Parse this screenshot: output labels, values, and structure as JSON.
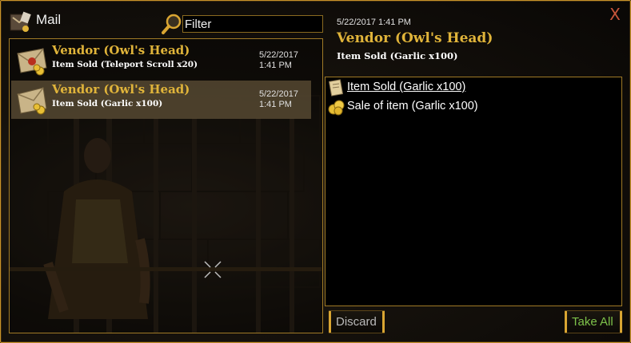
{
  "window": {
    "title": "Mail",
    "close_label": "X"
  },
  "filter": {
    "value": "Filter"
  },
  "messages": [
    {
      "sender": "Vendor (Owl's Head)",
      "subject": "Item Sold (Teleport Scroll x20)",
      "date": "5/22/2017",
      "time": "1:41 PM",
      "selected": false
    },
    {
      "sender": "Vendor (Owl's Head)",
      "subject": "Item Sold (Garlic x100)",
      "date": "5/22/2017",
      "time": "1:41 PM",
      "selected": true
    }
  ],
  "detail": {
    "datetime": "5/22/2017 1:41 PM",
    "sender": "Vendor (Owl's Head)",
    "subject": "Item Sold (Garlic x100)",
    "attachments": [
      {
        "label": "Item Sold (Garlic x100)",
        "icon": "scroll-icon"
      },
      {
        "label": "Sale of item (Garlic x100)",
        "icon": "gold-coins-icon"
      }
    ]
  },
  "buttons": {
    "discard": "Discard",
    "take_all": "Take All"
  },
  "colors": {
    "accent_gold": "#e0b43a",
    "border_gold": "#c9932a",
    "close_red": "#c8553a",
    "take_all_green": "#7dc24a"
  }
}
